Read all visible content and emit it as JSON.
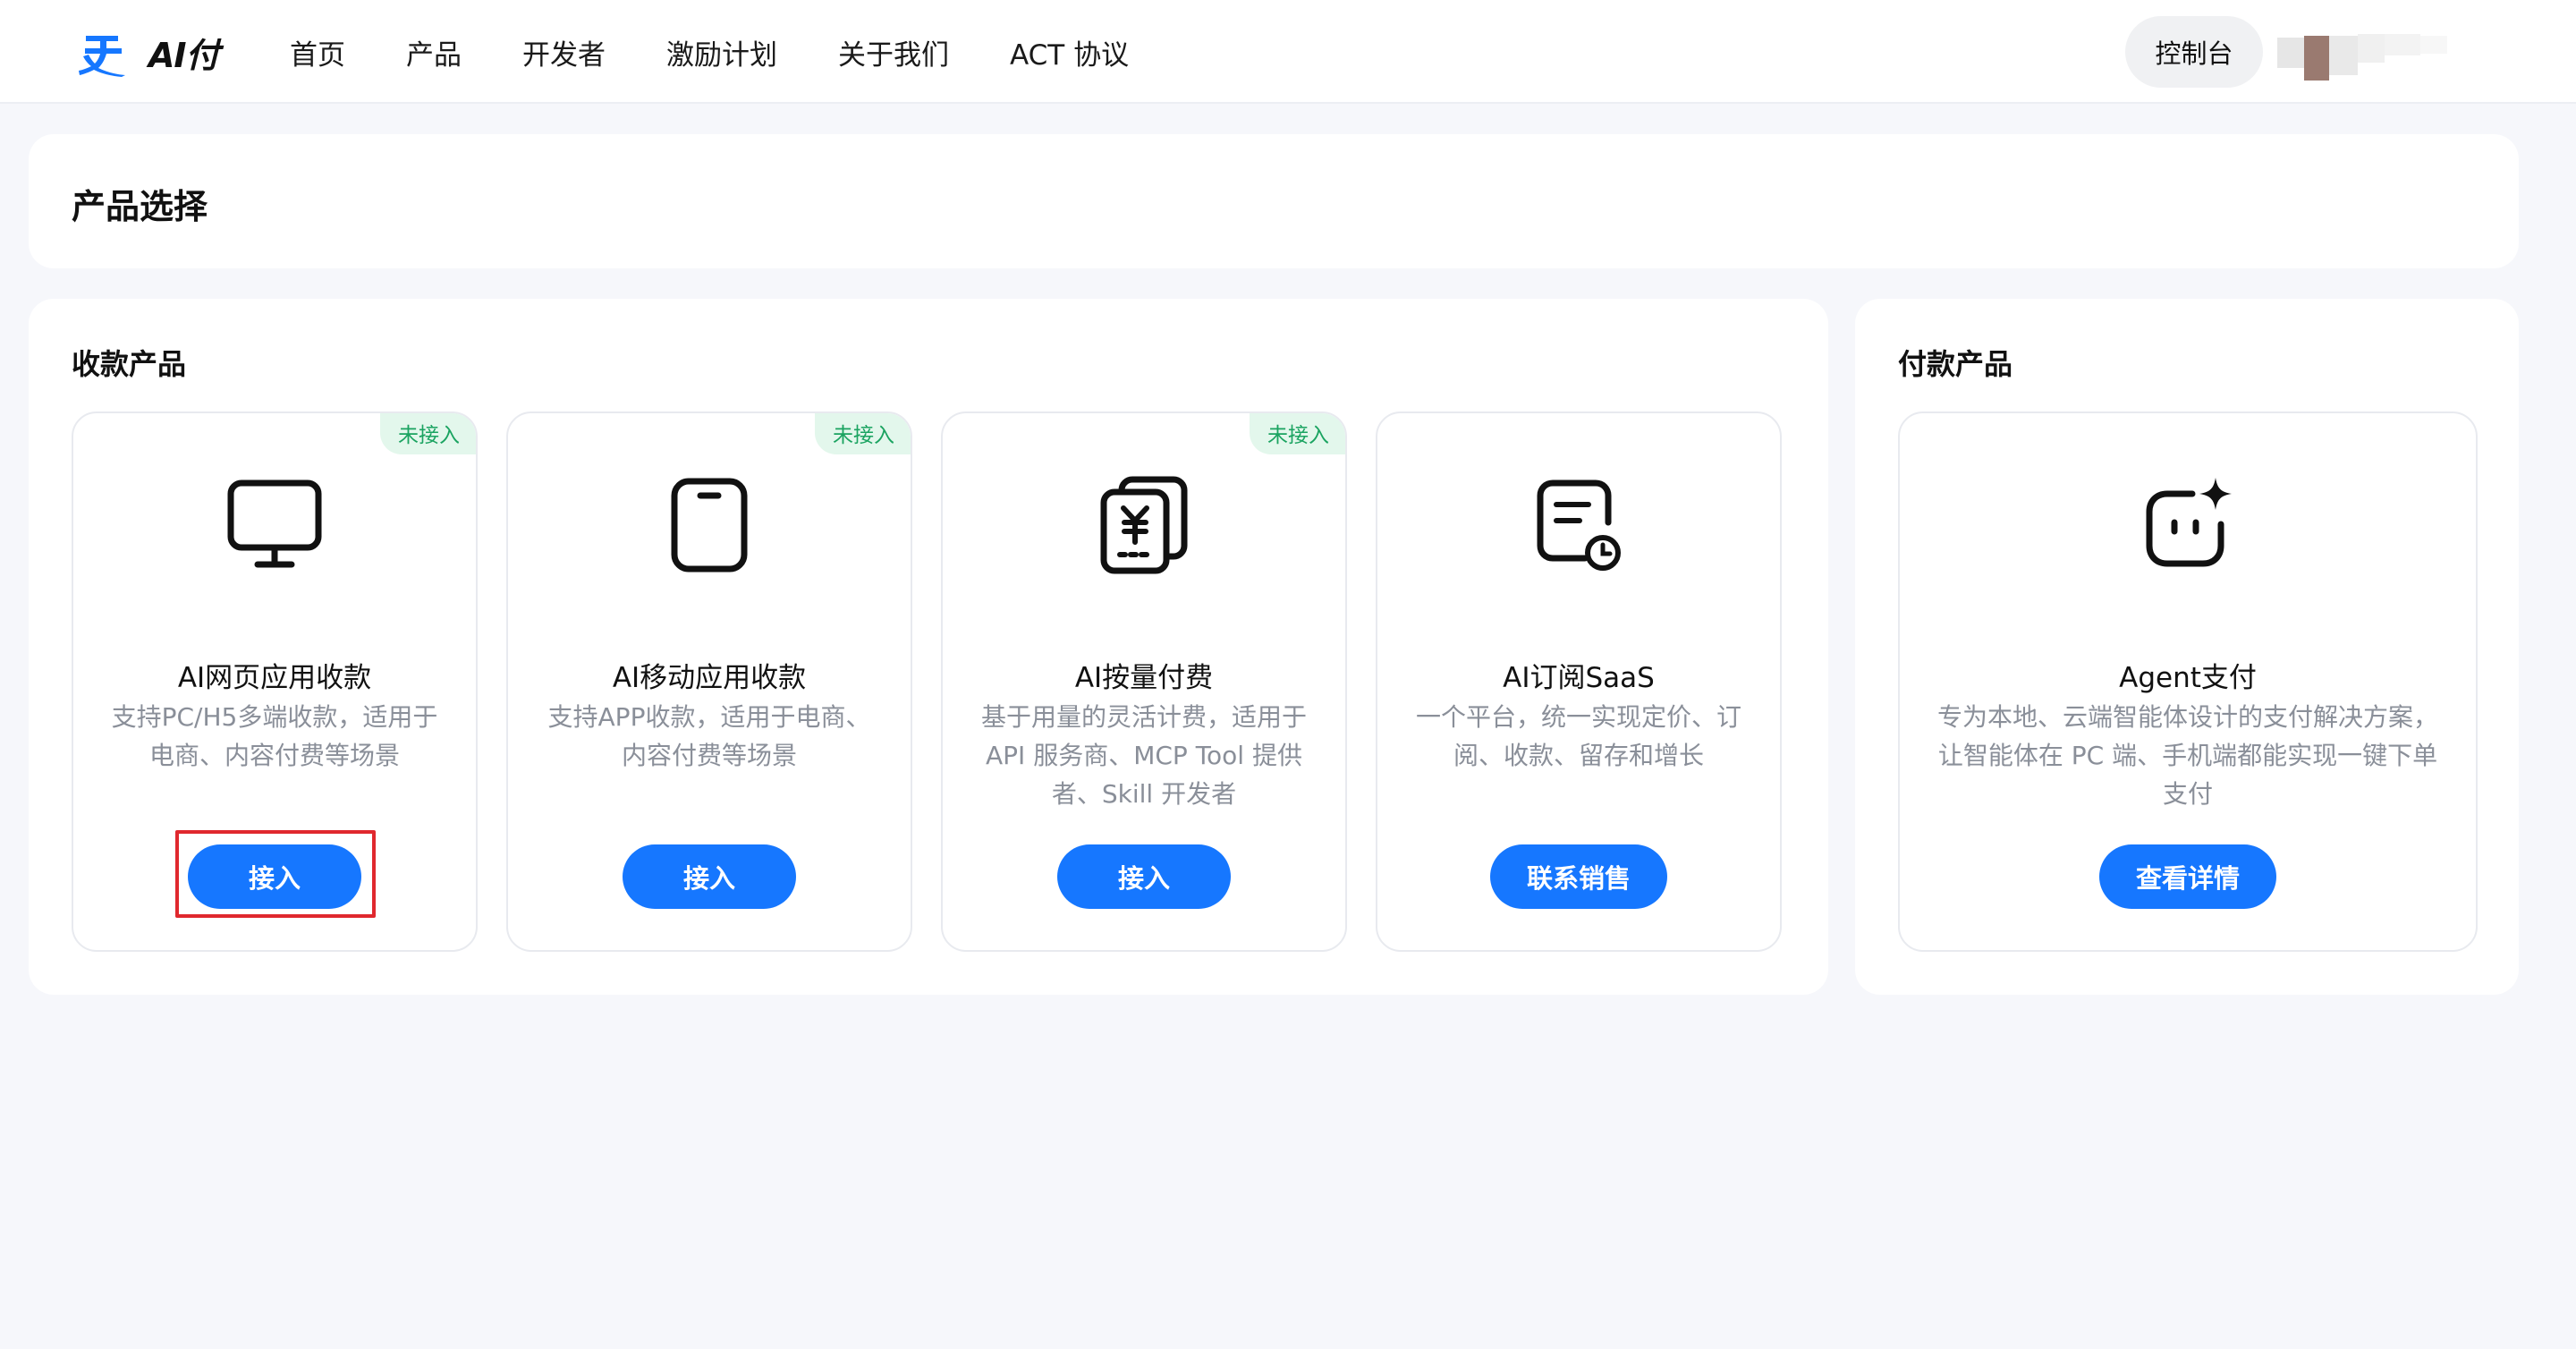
{
  "header": {
    "logo_text": "AI付",
    "nav": [
      "首页",
      "产品",
      "开发者",
      "激励计划",
      "关于我们",
      "ACT 协议"
    ],
    "console_label": "控制台"
  },
  "page_title": "产品选择",
  "sections": {
    "collect": {
      "title": "收款产品",
      "products": [
        {
          "name": "AI网页应用收款",
          "desc": "支持PC/H5多端收款，适用于电商、内容付费等场景",
          "badge": "未接入",
          "button": "接入",
          "icon": "monitor-icon"
        },
        {
          "name": "AI移动应用收款",
          "desc": "支持APP收款，适用于电商、内容付费等场景",
          "badge": "未接入",
          "button": "接入",
          "icon": "mobile-icon"
        },
        {
          "name": "AI按量付费",
          "desc": "基于用量的灵活计费，适用于API 服务商、MCP Tool 提供者、Skill 开发者",
          "badge": "未接入",
          "button": "接入",
          "icon": "yuan-bill-icon"
        },
        {
          "name": "AI订阅SaaS",
          "desc": "一个平台，统一实现定价、订阅、收款、留存和增长",
          "badge": "",
          "button": "联系销售",
          "icon": "subscription-clock-icon"
        }
      ]
    },
    "pay": {
      "title": "付款产品",
      "products": [
        {
          "name": "Agent支付",
          "desc": "专为本地、云端智能体设计的支付解决方案，让智能体在 PC 端、手机端都能实现一键下单支付",
          "button": "查看详情",
          "icon": "agent-sparkle-icon"
        }
      ]
    }
  },
  "colors": {
    "primary": "#1677ff",
    "badge_bg": "#e3f7ec",
    "badge_text": "#1aa360",
    "highlight": "#e0282e",
    "page_bg": "#f6f7fb"
  }
}
